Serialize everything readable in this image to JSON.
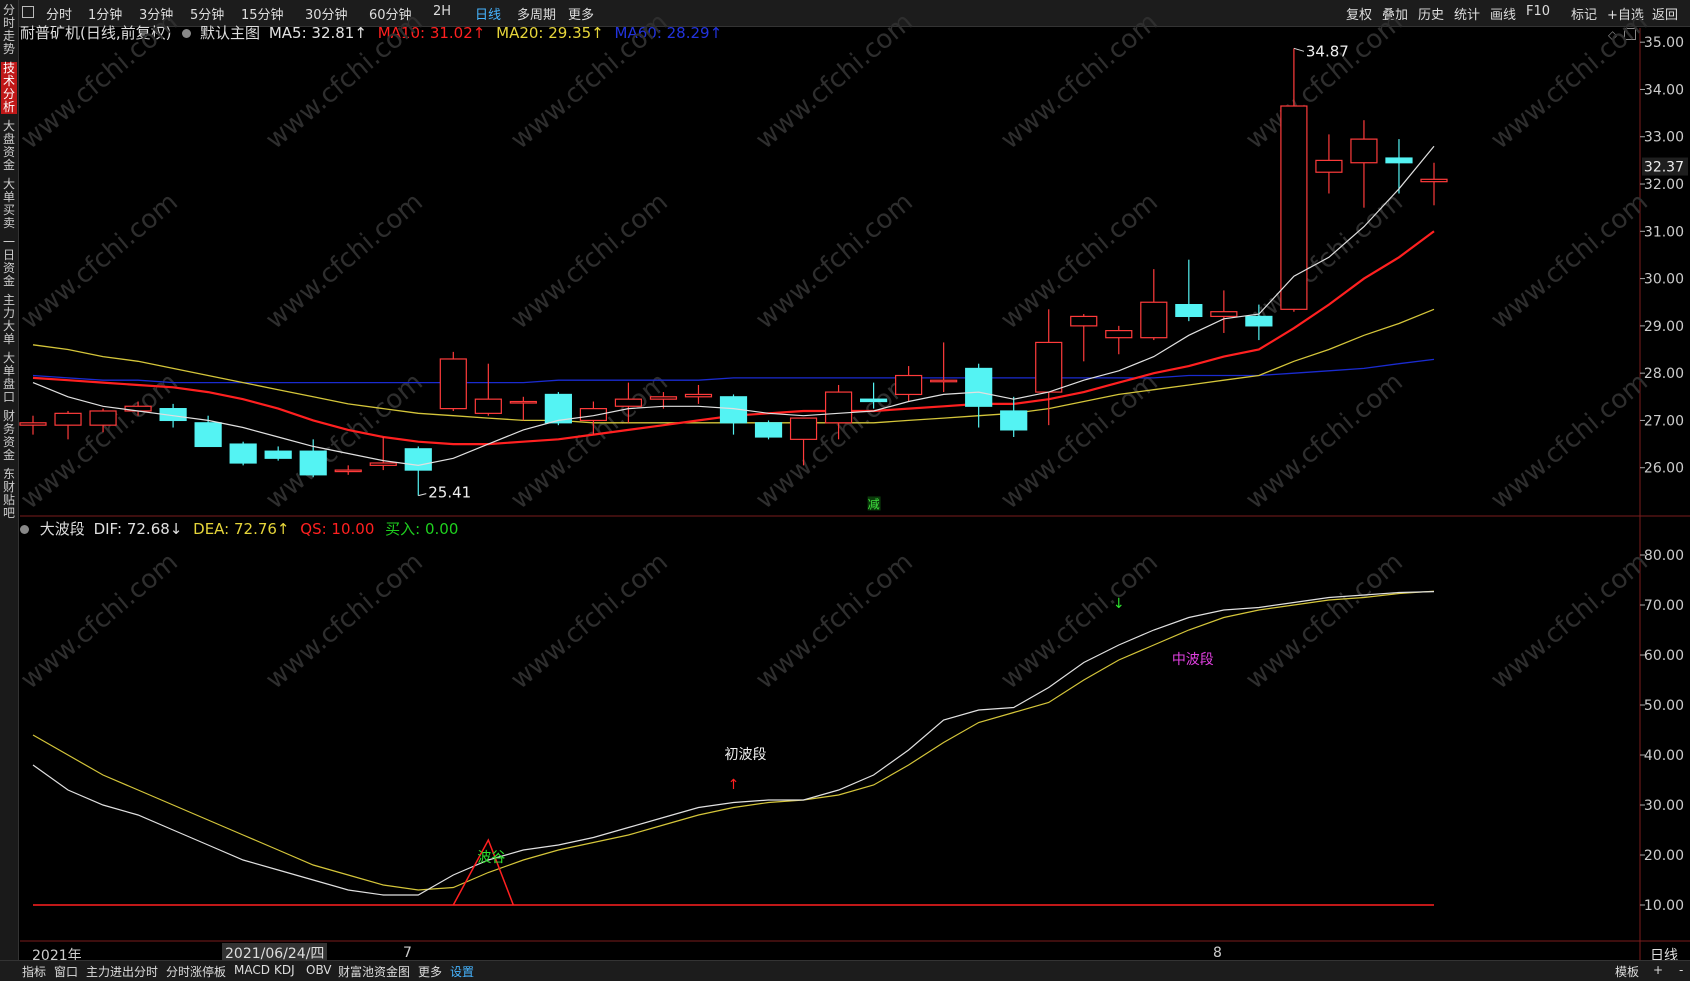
{
  "toolbar": {
    "icon": "window-icon",
    "periods": [
      "分时",
      "1分钟",
      "3分钟",
      "5分钟",
      "15分钟",
      "30分钟",
      "60分钟",
      "2H",
      "日线",
      "多周期",
      "更多"
    ],
    "active_period": "日线",
    "right_items": [
      "复权",
      "叠加",
      "历史",
      "统计",
      "画线",
      "F10",
      "标记",
      "+自选",
      "返回"
    ]
  },
  "side_tabs": [
    "分时走势",
    "技术分析",
    "大盘资金",
    "大单买卖",
    "一日资金",
    "主力大单",
    "大单盘口",
    "财务资金",
    "东财贴吧"
  ],
  "active_side_tab": "技术分析",
  "main_legend": {
    "name": "耐普矿机(日线,前复权)",
    "template": "默认主图",
    "ma5": "MA5: 32.81↑",
    "ma10": "MA10: 31.02↑",
    "ma20": "MA20: 29.35↑",
    "ma60": "MA60: 28.29↑"
  },
  "sub_legend": {
    "name": "大波段",
    "dif": "DIF: 72.68↓",
    "dea": "DEA: 72.76↑",
    "qs": "QS: 10.00",
    "buy": "买入: 0.00"
  },
  "date_axis": {
    "year": "2021年",
    "cursor": "2021/06/24/四",
    "m7": "7",
    "m8": "8",
    "period": "日线"
  },
  "bottom_tabs": [
    "指标",
    "窗口",
    "主力进出分时",
    "分时涨停板",
    "MACD",
    "KDJ",
    "OBV",
    "财富池资金图",
    "更多",
    "设置"
  ],
  "bottom_right": [
    "模板",
    "+",
    "-"
  ],
  "watermark": "www.cfchi.com",
  "colors": {
    "up": "#ff3b3b",
    "down": "#54f3f3",
    "ma5": "#e0e0e0",
    "ma10": "#ff2020",
    "ma20": "#d4c53a",
    "ma60": "#1a2bd0",
    "dif": "#e0e0e0",
    "dea": "#d4c53a",
    "qs": "#ff2020",
    "buy": "#1fd01f"
  },
  "chart_data": [
    {
      "type": "candlestick",
      "title": "耐普矿机(日线,前复权)",
      "price_ticks": [
        "35.00",
        "34.00",
        "33.00",
        "32.00",
        "31.00",
        "30.00",
        "29.00",
        "28.00",
        "27.00",
        "26.00"
      ],
      "last_price": "32.37",
      "ylim": [
        25.0,
        35.3
      ],
      "candles": [
        {
          "o": 26.9,
          "h": 27.1,
          "l": 26.7,
          "c": 26.95
        },
        {
          "o": 26.9,
          "h": 27.2,
          "l": 26.6,
          "c": 27.15
        },
        {
          "o": 26.9,
          "h": 27.25,
          "l": 26.75,
          "c": 27.2
        },
        {
          "o": 27.2,
          "h": 27.4,
          "l": 27.1,
          "c": 27.3
        },
        {
          "o": 27.25,
          "h": 27.35,
          "l": 26.85,
          "c": 27.0
        },
        {
          "o": 26.95,
          "h": 27.1,
          "l": 26.5,
          "c": 26.45
        },
        {
          "o": 26.5,
          "h": 26.55,
          "l": 26.05,
          "c": 26.1
        },
        {
          "o": 26.35,
          "h": 26.45,
          "l": 26.15,
          "c": 26.2
        },
        {
          "o": 26.35,
          "h": 26.6,
          "l": 25.8,
          "c": 25.85
        },
        {
          "o": 25.95,
          "h": 26.05,
          "l": 25.85,
          "c": 25.95
        },
        {
          "o": 26.05,
          "h": 26.65,
          "l": 25.95,
          "c": 26.1
        },
        {
          "o": 26.4,
          "h": 26.45,
          "l": 25.41,
          "c": 25.95
        },
        {
          "o": 27.25,
          "h": 28.45,
          "l": 27.2,
          "c": 28.3
        },
        {
          "o": 27.15,
          "h": 28.2,
          "l": 27.1,
          "c": 27.45
        },
        {
          "o": 27.4,
          "h": 27.5,
          "l": 27.0,
          "c": 27.4
        },
        {
          "o": 27.55,
          "h": 27.6,
          "l": 26.9,
          "c": 26.95
        },
        {
          "o": 27.0,
          "h": 27.4,
          "l": 26.7,
          "c": 27.25
        },
        {
          "o": 27.3,
          "h": 27.8,
          "l": 26.95,
          "c": 27.45
        },
        {
          "o": 27.45,
          "h": 27.6,
          "l": 27.25,
          "c": 27.5
        },
        {
          "o": 27.5,
          "h": 27.75,
          "l": 27.35,
          "c": 27.55
        },
        {
          "o": 27.5,
          "h": 27.55,
          "l": 26.7,
          "c": 26.95
        },
        {
          "o": 26.95,
          "h": 27.0,
          "l": 26.6,
          "c": 26.65
        },
        {
          "o": 26.6,
          "h": 27.05,
          "l": 26.05,
          "c": 27.05
        },
        {
          "o": 26.95,
          "h": 27.75,
          "l": 26.6,
          "c": 27.6
        },
        {
          "o": 27.45,
          "h": 27.8,
          "l": 27.25,
          "c": 27.4
        },
        {
          "o": 27.55,
          "h": 28.15,
          "l": 27.4,
          "c": 27.95
        },
        {
          "o": 27.85,
          "h": 28.65,
          "l": 27.6,
          "c": 27.85
        },
        {
          "o": 28.1,
          "h": 28.2,
          "l": 26.85,
          "c": 27.3
        },
        {
          "o": 27.2,
          "h": 27.5,
          "l": 26.65,
          "c": 26.8
        },
        {
          "o": 27.6,
          "h": 29.35,
          "l": 26.9,
          "c": 28.65
        },
        {
          "o": 29.0,
          "h": 29.25,
          "l": 28.25,
          "c": 29.2
        },
        {
          "o": 28.75,
          "h": 29.0,
          "l": 28.4,
          "c": 28.9
        },
        {
          "o": 28.75,
          "h": 30.2,
          "l": 28.7,
          "c": 29.5
        },
        {
          "o": 29.45,
          "h": 30.4,
          "l": 29.1,
          "c": 29.2
        },
        {
          "o": 29.2,
          "h": 29.75,
          "l": 28.85,
          "c": 29.3
        },
        {
          "o": 29.2,
          "h": 29.45,
          "l": 28.7,
          "c": 29.0
        },
        {
          "o": 29.35,
          "h": 34.87,
          "l": 29.3,
          "c": 33.65
        },
        {
          "o": 32.25,
          "h": 33.05,
          "l": 31.8,
          "c": 32.5
        },
        {
          "o": 32.45,
          "h": 33.35,
          "l": 31.5,
          "c": 32.95
        },
        {
          "o": 32.55,
          "h": 32.95,
          "l": 31.8,
          "c": 32.45
        },
        {
          "o": 32.05,
          "h": 32.45,
          "l": 31.55,
          "c": 32.1
        }
      ],
      "ma5": [
        27.8,
        27.5,
        27.3,
        27.2,
        27.1,
        27.0,
        26.85,
        26.65,
        26.45,
        26.3,
        26.15,
        26.05,
        26.2,
        26.5,
        26.8,
        27.0,
        27.1,
        27.25,
        27.3,
        27.3,
        27.25,
        27.15,
        27.1,
        27.15,
        27.2,
        27.4,
        27.55,
        27.6,
        27.45,
        27.6,
        27.85,
        28.05,
        28.35,
        28.8,
        29.15,
        29.25,
        30.05,
        30.45,
        31.1,
        31.9,
        32.8
      ],
      "ma10": [
        27.9,
        27.85,
        27.8,
        27.75,
        27.7,
        27.6,
        27.45,
        27.25,
        27.0,
        26.8,
        26.65,
        26.55,
        26.5,
        26.5,
        26.55,
        26.6,
        26.7,
        26.8,
        26.9,
        27.0,
        27.1,
        27.15,
        27.2,
        27.2,
        27.2,
        27.25,
        27.3,
        27.35,
        27.35,
        27.45,
        27.6,
        27.8,
        28.0,
        28.15,
        28.35,
        28.5,
        28.95,
        29.45,
        30.0,
        30.45,
        31.0
      ],
      "ma20": [
        28.6,
        28.5,
        28.35,
        28.25,
        28.1,
        27.95,
        27.8,
        27.65,
        27.5,
        27.35,
        27.25,
        27.15,
        27.1,
        27.05,
        27.0,
        27.0,
        26.95,
        26.95,
        26.95,
        26.95,
        26.95,
        26.95,
        26.95,
        26.95,
        26.95,
        27.0,
        27.05,
        27.1,
        27.15,
        27.25,
        27.4,
        27.55,
        27.65,
        27.75,
        27.85,
        27.95,
        28.25,
        28.5,
        28.8,
        29.05,
        29.35
      ],
      "ma60": [
        27.95,
        27.9,
        27.85,
        27.85,
        27.8,
        27.8,
        27.8,
        27.8,
        27.8,
        27.8,
        27.8,
        27.8,
        27.8,
        27.8,
        27.8,
        27.85,
        27.85,
        27.85,
        27.85,
        27.85,
        27.9,
        27.9,
        27.9,
        27.9,
        27.9,
        27.9,
        27.9,
        27.9,
        27.9,
        27.9,
        27.9,
        27.9,
        27.9,
        27.95,
        27.95,
        27.95,
        28.0,
        28.05,
        28.1,
        28.2,
        28.29
      ],
      "annotations": [
        {
          "text": "34.87",
          "idx": 36,
          "price": 34.87
        },
        {
          "text": "25.41",
          "idx": 11,
          "price": 25.41
        },
        {
          "text": "减",
          "idx": 24,
          "price": 25.35
        }
      ]
    },
    {
      "type": "line",
      "title": "大波段",
      "y_ticks": [
        "80.00",
        "70.00",
        "60.00",
        "50.00",
        "40.00",
        "30.00",
        "20.00",
        "10.00"
      ],
      "ylim": [
        3,
        84
      ],
      "series": [
        {
          "name": "DIF",
          "values": [
            38,
            33,
            30,
            28,
            25,
            22,
            19,
            17,
            15,
            13,
            12,
            12,
            16,
            19,
            21,
            22,
            23.5,
            25.5,
            27.5,
            29.5,
            30.5,
            31,
            31,
            33,
            36,
            41,
            47,
            49,
            49.5,
            53.5,
            58.5,
            62,
            65,
            67.5,
            69,
            69.5,
            70.5,
            71.5,
            72,
            72.5,
            72.68
          ]
        },
        {
          "name": "DEA",
          "values": [
            44,
            40,
            36,
            33,
            30,
            27,
            24,
            21,
            18,
            16,
            14,
            13,
            13.5,
            16.5,
            19,
            21,
            22.5,
            24,
            26,
            28,
            29.5,
            30.5,
            31,
            32,
            34,
            38,
            42.5,
            46.5,
            48.5,
            50.5,
            55,
            59,
            62,
            65,
            67.5,
            69,
            70,
            71,
            71.5,
            72.3,
            72.76
          ]
        },
        {
          "name": "QS",
          "values": [
            10,
            10,
            10,
            10,
            10,
            10,
            10,
            10,
            10,
            10,
            10,
            10,
            10,
            10,
            10,
            10,
            10,
            10,
            10,
            10,
            10,
            10,
            10,
            10,
            10,
            10,
            10,
            10,
            10,
            10,
            10,
            10,
            10,
            10,
            10,
            10,
            10,
            10,
            10,
            10,
            10
          ]
        }
      ],
      "annotations": [
        {
          "text": "波谷",
          "idx": 13,
          "value": 20
        },
        {
          "text": "初波段",
          "idx": 20,
          "value": 40
        },
        {
          "text": "中波段",
          "idx": 33,
          "value": 59
        }
      ],
      "x_labels": [
        "2021年",
        "2021/06/24/四",
        "7",
        "8"
      ]
    }
  ]
}
